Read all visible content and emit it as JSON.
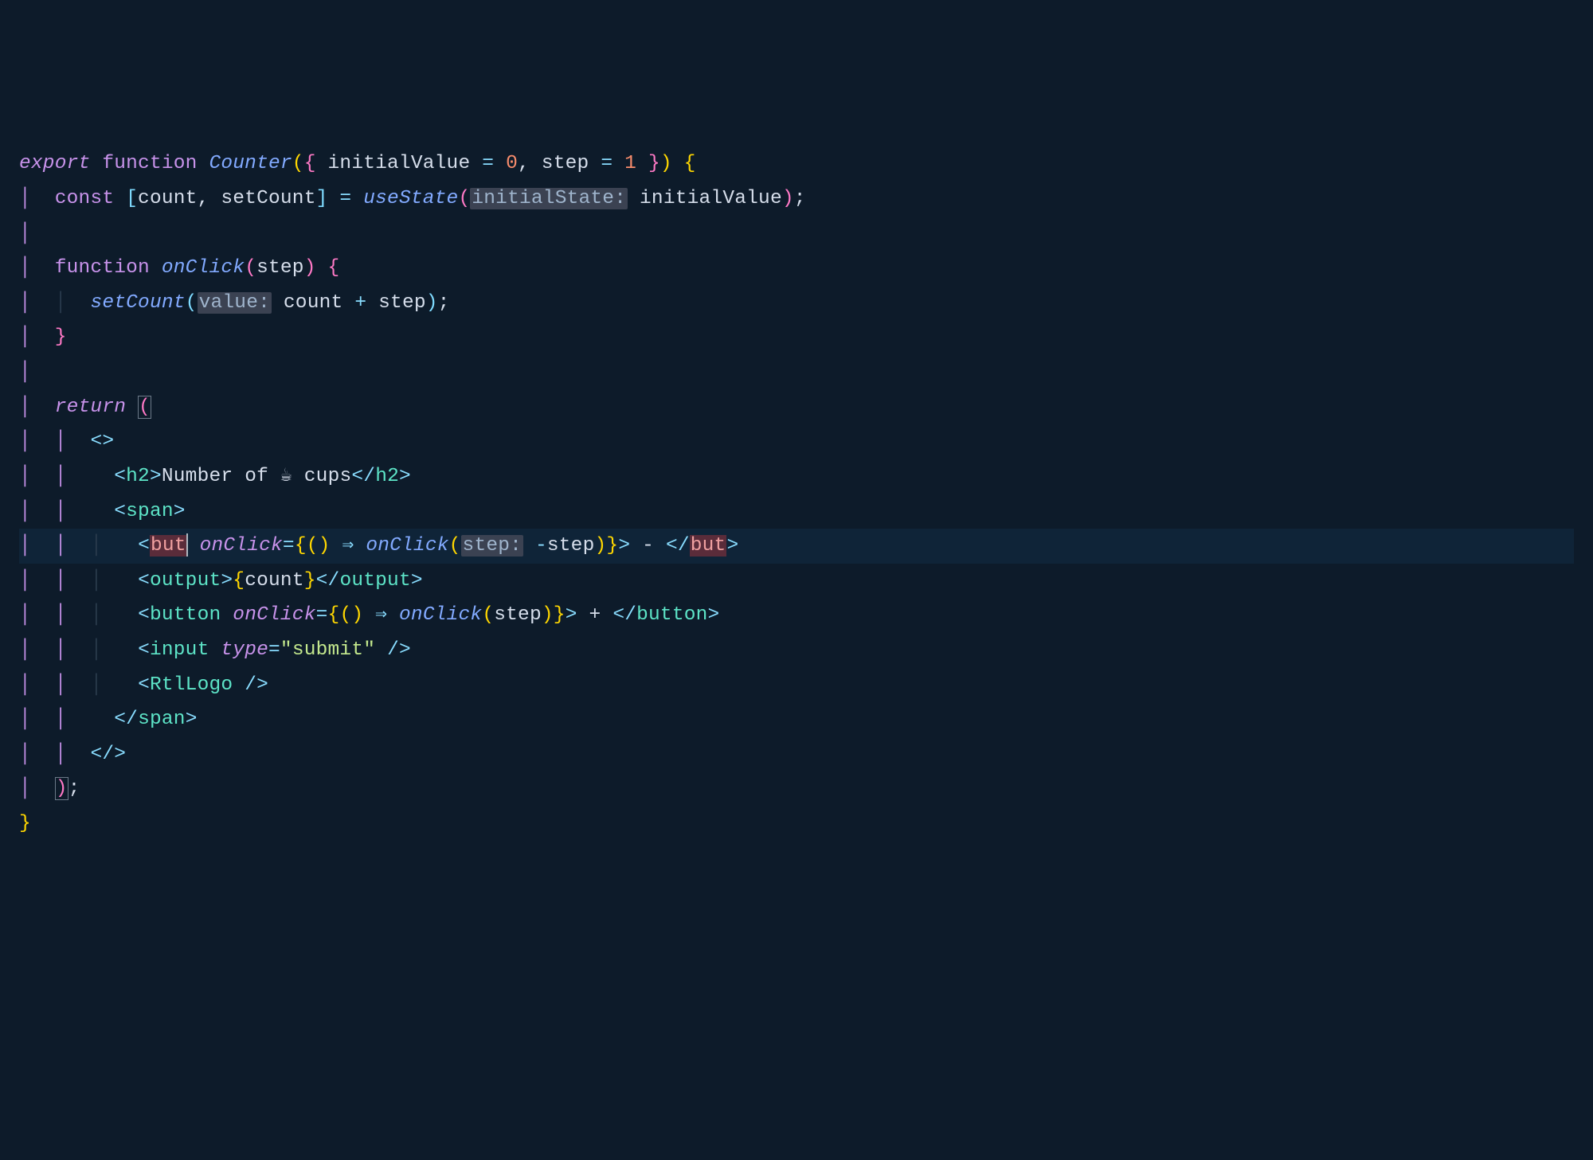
{
  "code": {
    "l1": {
      "export": "export",
      "function": "function",
      "name": "Counter",
      "param1": "initialValue",
      "eq1": "=",
      "val1": "0",
      "comma": ",",
      "param2": "step",
      "eq2": "=",
      "val2": "1"
    },
    "l2": {
      "const": "const",
      "count": "count",
      "comma": ",",
      "setCount": "setCount",
      "eq": "=",
      "useState": "useState",
      "inlay": "initialState:",
      "arg": "initialValue",
      "semi": ";"
    },
    "l4": {
      "function": "function",
      "name": "onClick",
      "param": "step"
    },
    "l5": {
      "setCount": "setCount",
      "inlay": "value:",
      "count": "count",
      "plus": "+",
      "step": "step",
      "semi": ";"
    },
    "l8": {
      "return": "return"
    },
    "l10": {
      "h2open": "h2",
      "text1": "Number of ",
      "emoji": "☕",
      "text2": " cups",
      "h2close": "h2"
    },
    "l11": {
      "span": "span"
    },
    "l12": {
      "but_open": "but",
      "onClick": "onClick",
      "arrow": "⇒",
      "fn": "onClick",
      "inlay": "step:",
      "neg": "-",
      "step": "step",
      "text": " - ",
      "but_close": "but"
    },
    "l13": {
      "output": "output",
      "count": "count"
    },
    "l14": {
      "button": "button",
      "onClick": "onClick",
      "arrow": "⇒",
      "fn": "onClick",
      "step": "step",
      "text": " + "
    },
    "l15": {
      "input": "input",
      "type": "type",
      "val": "\"submit\""
    },
    "l16": {
      "rtl": "RtlLogo"
    },
    "l17": {
      "span": "span"
    },
    "l19": {
      "semi": ";"
    }
  }
}
